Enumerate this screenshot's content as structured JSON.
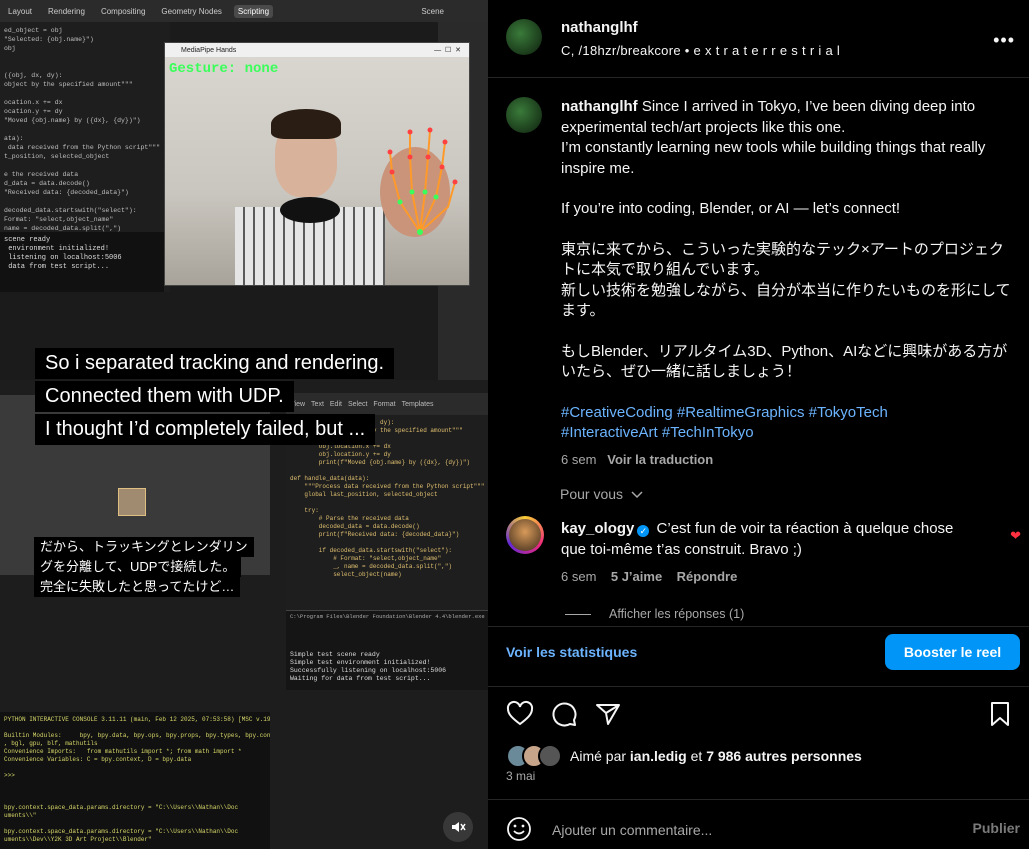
{
  "media": {
    "topbar_tabs": [
      "Layout",
      "Rendering",
      "Compositing",
      "Geometry Nodes",
      "Scripting"
    ],
    "active_tab": "Scripting",
    "scene_label": "Scene",
    "camera_window_title": "MediaPipe Hands",
    "gesture_text": "Gesture: none",
    "editor_code": "ed_object = obj\n\"Selected: {obj.name}\")\nobj\n\n\n({obj, dx, dy):\nobject by the specified amount\"\"\"\n\nocation.x += dx\nocation.y += dy\n\"Moved {obj.name} by ({dx}, {dy})\")\n\nata):\n data received from the Python script\"\"\"\nt_position, selected_object\n\ne the received data\nd_data = data.decode()\n\"Received data: {decoded_data}\")\n\ndecoded_data.startswith(\"select\"):\nFormat: \"select,object_name\"\nname = decoded_data.split(\",\")\nelect_object(name)",
    "console1": "scene ready\n environment initialized!\n listening on localhost:5006\n data from test script...",
    "code2": "def move_object(obj, dx, dy):\n    \"\"\"Move an object by the specified amount\"\"\"\n    if obj:\n        obj.location.x += dx\n        obj.location.y += dy\n        print(f\"Moved {obj.name} by ({dx}, {dy})\")\n\ndef handle_data(data):\n    \"\"\"Process data received from the Python script\"\"\"\n    global last_position, selected_object\n\n    try:\n        # Parse the received data\n        decoded_data = data.decode()\n        print(f\"Received data: {decoded_data}\")\n\n        if decoded_data.startswith(\"select\"):\n            # Format: \"select,object_name\"\n            _, name = decoded_data.split(\",\")\n            select_object(name)",
    "console2_title": "C:\\Program Files\\Blender Foundation\\Blender 4.4\\blender.exe",
    "console2": "Simple test scene ready\nSimple test environment initialized!\nSuccessfully listening on localhost:5006\nWaiting for data from test script...",
    "pyconsole": "PYTHON INTERACTIVE CONSOLE 3.11.11 (main, Feb 12 2025, 07:53:58) [MSC v.1929 64 bit (AMD64)]\n\nBuiltin Modules:     bpy, bpy.data, bpy.ops, bpy.props, bpy.types, bpy.context, bpy.utils\n, bgl, gpu, blf, mathutils\nConvenience Imports:   from mathutils import *; from math import *\nConvenience Variables: C = bpy.context, D = bpy.data\n\n>>>\n\n\n\nbpy.context.space_data.params.directory = \"C:\\\\Users\\\\Nathan\\\\Doc\numents\\\\\"\n\nbpy.context.space_data.params.directory = \"C:\\\\Users\\\\Nathan\\\\Doc\numents\\\\Dev\\\\Y2K 3D Art Project\\\\Blender\"\n\nbpy.ops.text.run_script()",
    "caption_en": [
      "So i separated tracking and rendering.",
      "Connected them with UDP.",
      "I thought I’d completely failed, but ..."
    ],
    "caption_jp": [
      "だから、トラッキングとレンダリン",
      "グを分離して、UDPで接続した。",
      "完全に失敗したと思ってたけど…"
    ]
  },
  "post": {
    "username": "nathanglhf",
    "subtitle": "C, /18hzr/breakcore • e x t r a t e r r e s t r i a l",
    "more_label": "•••",
    "caption_lines": [
      "Since I arrived in Tokyo, I’ve been diving deep into experimental tech/art projects like this one.",
      "I’m constantly learning new tools while building things that really inspire me.",
      "",
      "If you’re into coding, Blender, or AI — let’s connect!",
      "",
      "東京に来てから、こういった実験的なテック×アートのプロジェクトに本気で取り組んでいます。",
      "新しい技術を勉強しながら、自分が本当に作りたいものを形にしてます。",
      "",
      "もしBlender、リアルタイム3D、Python、AIなどに興味がある方がいたら、ぜひ一緒に話しましょう！"
    ],
    "hashtags_line1": "#CreativeCoding #RealtimeGraphics #TokyoTech",
    "hashtags_line2": "#InteractiveArt #TechInTokyo",
    "age": "6 sem",
    "translate_label": "Voir la traduction"
  },
  "for_you_label": "Pour vous",
  "comment": {
    "username": "kay_ology",
    "text": "C’est fun de voir ta réaction à quelque chose que toi-même t’as construit. Bravo ;)",
    "age": "6 sem",
    "likes": "5 J’aime",
    "reply_label": "Répondre",
    "show_replies": "Afficher les réponses (1)"
  },
  "stats_label": "Voir les statistiques",
  "boost_label": "Booster le reel",
  "likes": {
    "prefix": "Aimé par",
    "user": "ian.ledig",
    "middle": "et",
    "count": "7 986 autres personnes"
  },
  "date": "3 mai",
  "add_comment": {
    "placeholder": "Ajouter un commentaire...",
    "publish_label": "Publier"
  },
  "colors": {
    "accent": "#0095f6",
    "link": "#6cb4ff",
    "like_red": "#ff3040",
    "gesture_green": "#3aff5a"
  }
}
